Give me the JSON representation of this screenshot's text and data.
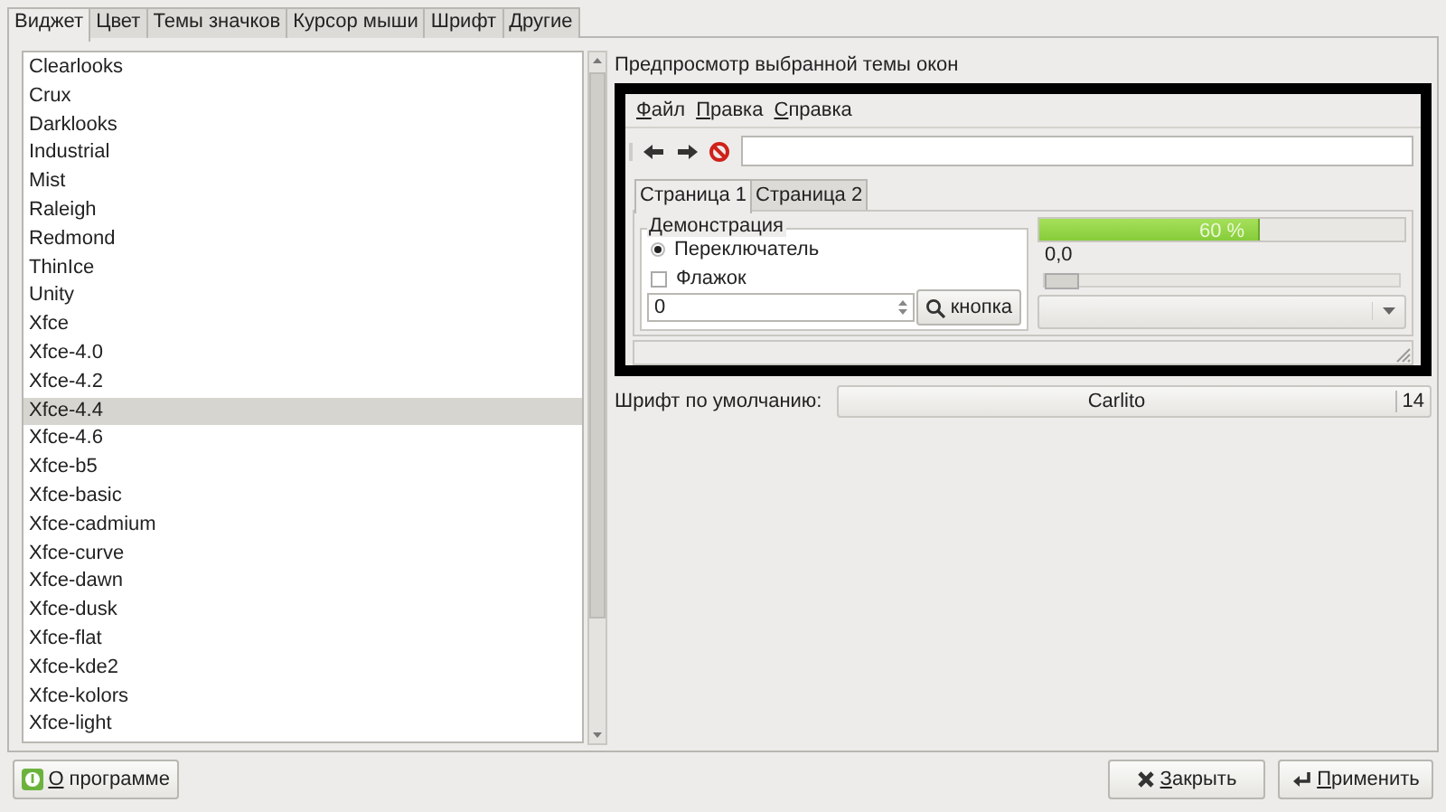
{
  "tabs": [
    {
      "label": "Виджет",
      "selected": true
    },
    {
      "label": "Цвет",
      "selected": false
    },
    {
      "label": "Темы значков",
      "selected": false
    },
    {
      "label": "Курсор мыши",
      "selected": false
    },
    {
      "label": "Шрифт",
      "selected": false
    },
    {
      "label": "Другие",
      "selected": false
    }
  ],
  "theme_list": {
    "items": [
      {
        "label": "Clearlooks",
        "selected": false
      },
      {
        "label": "Crux",
        "selected": false
      },
      {
        "label": "Darklooks",
        "selected": false
      },
      {
        "label": "Industrial",
        "selected": false
      },
      {
        "label": "Mist",
        "selected": false
      },
      {
        "label": "Raleigh",
        "selected": false
      },
      {
        "label": "Redmond",
        "selected": false
      },
      {
        "label": "ThinIce",
        "selected": false
      },
      {
        "label": "Unity",
        "selected": false
      },
      {
        "label": "Xfce",
        "selected": false
      },
      {
        "label": "Xfce-4.0",
        "selected": false
      },
      {
        "label": "Xfce-4.2",
        "selected": false
      },
      {
        "label": "Xfce-4.4",
        "selected": true
      },
      {
        "label": "Xfce-4.6",
        "selected": false
      },
      {
        "label": "Xfce-b5",
        "selected": false
      },
      {
        "label": "Xfce-basic",
        "selected": false
      },
      {
        "label": "Xfce-cadmium",
        "selected": false
      },
      {
        "label": "Xfce-curve",
        "selected": false
      },
      {
        "label": "Xfce-dawn",
        "selected": false
      },
      {
        "label": "Xfce-dusk",
        "selected": false
      },
      {
        "label": "Xfce-flat",
        "selected": false
      },
      {
        "label": "Xfce-kde2",
        "selected": false
      },
      {
        "label": "Xfce-kolors",
        "selected": false
      },
      {
        "label": "Xfce-light",
        "selected": false
      }
    ]
  },
  "preview": {
    "title": "Предпросмотр выбранной темы окон",
    "menu": [
      "Файл",
      "Правка",
      "Справка"
    ],
    "tabs": [
      {
        "label": "Страница 1",
        "selected": true
      },
      {
        "label": "Страница 2",
        "selected": false
      }
    ],
    "group_title": "Демонстрация",
    "radio": {
      "label": "Переключатель",
      "checked": true
    },
    "checkbox": {
      "label": "Флажок",
      "checked": false
    },
    "spin_value": "0",
    "button": "кнопка",
    "progress": {
      "level": 0.6,
      "text": "60 %"
    },
    "scale": {
      "reading": "0,0",
      "level": 0
    }
  },
  "font": {
    "label": "Шрифт по умолчанию:",
    "name": "Carlito",
    "size": "14"
  },
  "buttons": {
    "about": "О программе",
    "close": "Закрыть",
    "apply": "Применить"
  }
}
